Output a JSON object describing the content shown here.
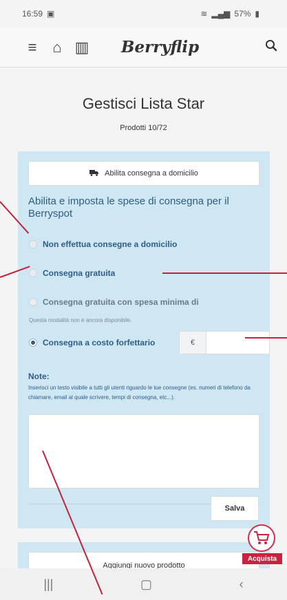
{
  "status": {
    "time": "16:59",
    "battery": "57%"
  },
  "header": {
    "logo": "Berryflip"
  },
  "page": {
    "title": "Gestisci Lista Star",
    "subtitle": "Prodotti 10/72"
  },
  "delivery": {
    "enable_button": "Abilita consegna a domicilio",
    "heading": "Abilita e imposta le spese di consegna per il Berryspot",
    "options": [
      {
        "label": "Non effettua consegne a domicilio",
        "checked": false
      },
      {
        "label": "Consegna gratuita",
        "checked": false
      },
      {
        "label": "Consegna gratuita con spesa minima di",
        "checked": false
      },
      {
        "label": "Consegna a costo forfettario",
        "checked": true
      }
    ],
    "disabled_note": "Questa modalità non è ancora disponibile.",
    "currency_symbol": "€",
    "notes_label": "Note:",
    "notes_help": "Inserisci un testo visibile a tutti gli utenti riguardo le tue consegne (es. numeri di telefono da chiamare, email al quale scrivere, tempi di consegna, etc...).",
    "save_button": "Salva"
  },
  "add_product_button": "Aggiungi nuovo prodotto",
  "cart_badge": {
    "label": "Acquista"
  },
  "colors": {
    "accent": "#2e5d86",
    "panel": "#cfe6f3",
    "annotation": "#c4213b"
  }
}
